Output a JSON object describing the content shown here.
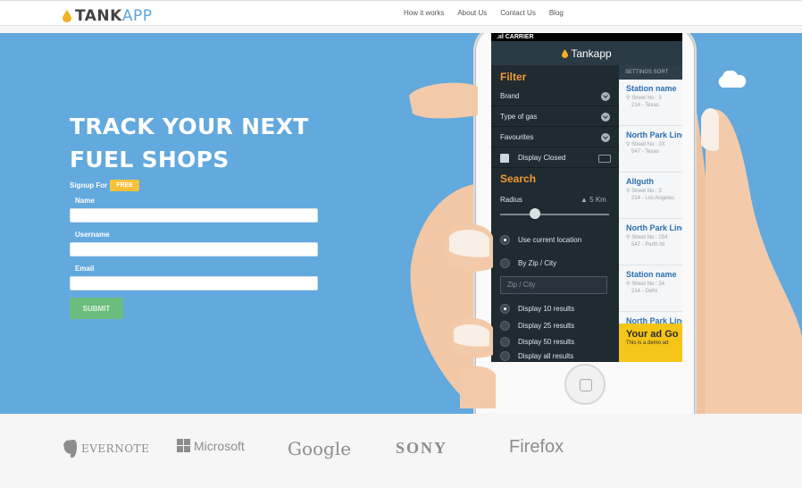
{
  "nav": {
    "logo_part1": "TANK",
    "logo_part2": "APP",
    "links": [
      "How it works",
      "About Us",
      "Contact Us",
      "Blog"
    ]
  },
  "hero": {
    "headline_line1": "TRACK YOUR NEXT",
    "headline_line2": "FUEL SHOPS",
    "signup_text": "Signup For",
    "free_badge": "FREE",
    "fields": {
      "name_label": "Name",
      "username_label": "Username",
      "email_label": "Email"
    },
    "submit_label": "SUBMIT"
  },
  "app": {
    "carrier": ".ııl CARRIER",
    "title": "Tankapp",
    "filter_heading": "Filter",
    "filters": [
      "Brand",
      "Type of gas",
      "Favourites"
    ],
    "display_closed": "Display Closed",
    "search_heading": "Search",
    "radius_label": "Radius",
    "radius_value": "5 Km",
    "location_options": [
      "Use current location",
      "By Zip / City"
    ],
    "zip_placeholder": "Zip / City",
    "result_options": [
      "Display 10 results",
      "Display 25 results",
      "Display 50 results",
      "Display all results"
    ],
    "list_tabs": "SETTINGS   SORT",
    "stations": [
      {
        "name": "Station name",
        "street": "Street No : 3",
        "area": "214 - Texas"
      },
      {
        "name": "North Park Line",
        "street": "Street No : 2X",
        "area": "547 - Texas"
      },
      {
        "name": "Allguth",
        "street": "Street No : 3",
        "area": "214 - Los Angeles"
      },
      {
        "name": "North Park Line",
        "street": "Street No : 254",
        "area": "547 - Perth Ni"
      },
      {
        "name": "Station name",
        "street": "Street No : 34",
        "area": "214 - Delhi"
      },
      {
        "name": "North Park Line",
        "street": "",
        "area": ""
      }
    ],
    "ad_title": "Your ad Go",
    "ad_sub": "This is a demo ad"
  },
  "brands": [
    "EVERNOTE",
    "Microsoft",
    "Google",
    "SONY",
    "Firefox"
  ],
  "colors": {
    "hero_bg": "#62a9dd",
    "accent_orange": "#f29a33",
    "free_badge": "#f7c23a",
    "submit_green": "#6bbd7d",
    "logo_blue": "#5aa5dc"
  }
}
